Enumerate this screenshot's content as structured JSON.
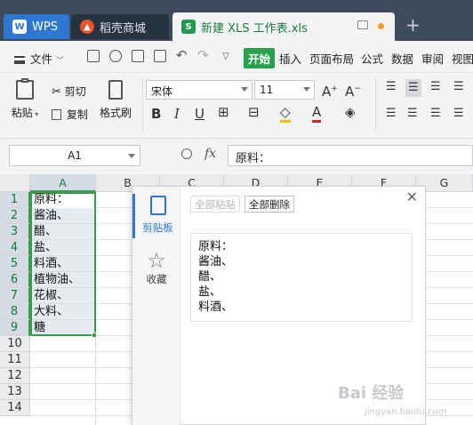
{
  "tabs": {
    "wps": "WPS",
    "daoke": "稻壳商城",
    "doc": "新建 XLS 工作表.xls",
    "new": "+"
  },
  "menu": {
    "file": "文件",
    "items": [
      "开始",
      "插入",
      "页面布局",
      "公式",
      "数据",
      "审阅",
      "视图"
    ]
  },
  "ribbon": {
    "paste": "粘贴",
    "cut": "剪切",
    "copy": "复制",
    "format_painter": "格式刷",
    "font_name": "宋体",
    "font_size": "11"
  },
  "formula_bar": {
    "cell_ref": "A1",
    "fx": "fx",
    "content": "原料："
  },
  "sheet": {
    "columns": [
      "A",
      "B",
      "C",
      "D",
      "E",
      "F",
      "G"
    ],
    "rows": [
      "1",
      "2",
      "3",
      "4",
      "5",
      "6",
      "7",
      "8",
      "9",
      "10",
      "11",
      "12",
      "13",
      "14"
    ],
    "col_a_values": [
      "原料：",
      "酱油、",
      "醋、",
      "盐、",
      "料酒、",
      "植物油、",
      "花椒、",
      "大料、",
      "糖"
    ]
  },
  "clipboard_panel": {
    "nav_clipboard": "剪贴板",
    "nav_favorites": "收藏",
    "paste_all": "全部粘贴",
    "delete_all": "全部删除",
    "item_lines": [
      "原料：",
      "酱油、",
      "醋、",
      "盐、",
      "料酒、"
    ]
  },
  "watermark": {
    "text": "Bai 经验",
    "url": "jingyan.baidu.com"
  },
  "colors": {
    "accent_green": "#27a24a",
    "selection_border": "#3a9b4c",
    "titlebar": "#3f4b5b",
    "wps_tab": "#2e77d0"
  }
}
